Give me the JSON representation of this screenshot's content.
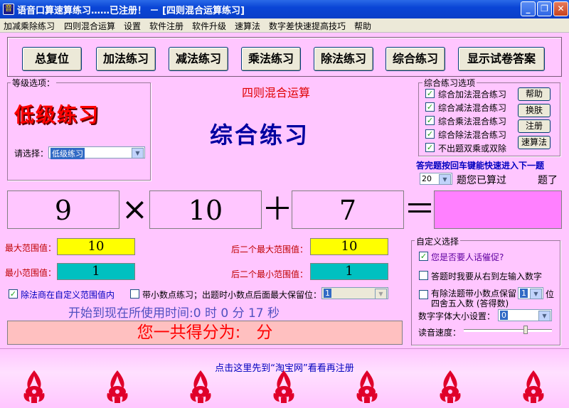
{
  "window": {
    "title": "语音口算速算练习……已注册！ － [四则混合运算练习]",
    "icon": "app-icon"
  },
  "menu": [
    "加减乘除练习",
    "四则混合运算",
    "设置",
    "软件注册",
    "软件升级",
    "速算法",
    "数字差快速提高技巧",
    "帮助"
  ],
  "toolbar": [
    "总复位",
    "加法练习",
    "减法练习",
    "乘法练习",
    "除法练习",
    "综合练习",
    "显示试卷答案"
  ],
  "level": {
    "group_label": "等级选项：",
    "title": "低级练习",
    "select_label": "请选择：",
    "select_value": "低级练习"
  },
  "center": {
    "subtitle": "四则混合运算",
    "title": "综合练习"
  },
  "mix_options": {
    "group_label": "综合练习选项",
    "items": [
      {
        "label": "综合加法混合练习",
        "checked": true
      },
      {
        "label": "综合减法混合练习",
        "checked": true
      },
      {
        "label": "综合乘法混合练习",
        "checked": true
      },
      {
        "label": "综合除法混合练习",
        "checked": true
      },
      {
        "label": "不出题双乘或双除",
        "checked": true
      }
    ],
    "buttons": [
      "帮助",
      "换肤",
      "注册",
      "速算法"
    ]
  },
  "hint": {
    "enter_tip": "答完题按回车键能快速进入下一题",
    "count_value": "20",
    "done_label": "题您已算过",
    "done_suffix": "题了"
  },
  "problem": {
    "a": "9",
    "op1": "×",
    "b": "10",
    "op2": "＋",
    "c": "7",
    "eq": "＝",
    "answer": ""
  },
  "ranges": {
    "max_label": "最大范围值：",
    "max_value": "10",
    "min_label": "最小范围值：",
    "min_value": "1",
    "last2_max_label": "后二个最大范围值：",
    "last2_max_value": "10",
    "last2_min_label": "后二个最小范围值：",
    "last2_min_value": "1"
  },
  "options_row": {
    "divisor_label": "除法商在自定义范围值内",
    "decimal_label": "带小数点练习；出题时小数点后面最大保留位：",
    "decimal_value": "1"
  },
  "timer": "开始到现在所使用时间:0 时 0 分 17 秒",
  "score": "您一共得分为:   分",
  "custom": {
    "group_label": "自定义选择",
    "urge": "您是否要人话催促?",
    "rtl": "答题时我要从右到左输入数字",
    "round_label": "有除法题带小数点保留",
    "round_value": "1",
    "round_unit": "位",
    "round_note": "四舍五入数 (答得数)",
    "font_label": "数字字体大小设置：",
    "font_value": "0",
    "speed_label": "读音速度："
  },
  "footer": {
    "link": "点击这里先到“淘宝网”看看再注册"
  },
  "colors": {
    "bg": "#ffc6ff",
    "yellow": "#ffff00",
    "teal": "#00c0c0",
    "answer": "#ff80ff",
    "red": "#ff0000",
    "navy": "#0000a0"
  }
}
